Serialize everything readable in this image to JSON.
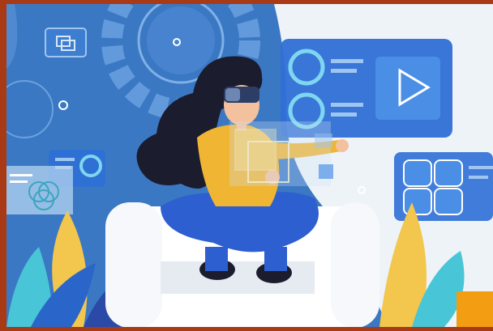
{
  "image": {
    "kind": "illustration",
    "colors": {
      "border": "#a83a16",
      "background_blue": "#3b78c4",
      "background_light": "#eef3f8",
      "panel_blue": "#2f6fd6",
      "panel_light": "#9ec6f0",
      "sweater_yellow": "#f0b533",
      "pants_blue": "#2d5fd0",
      "hair": "#1b1c2e",
      "skin": "#f4c19e",
      "couch": "#ffffff",
      "leaf_yellow": "#f3c64d",
      "leaf_teal": "#48c5d6",
      "leaf_navy": "#2b4aa8",
      "corner_orange": "#f29d12"
    },
    "icons": [
      "play-icon",
      "grid-icon",
      "layers-icon",
      "circles-icon",
      "window-icon",
      "vr-headset"
    ]
  }
}
